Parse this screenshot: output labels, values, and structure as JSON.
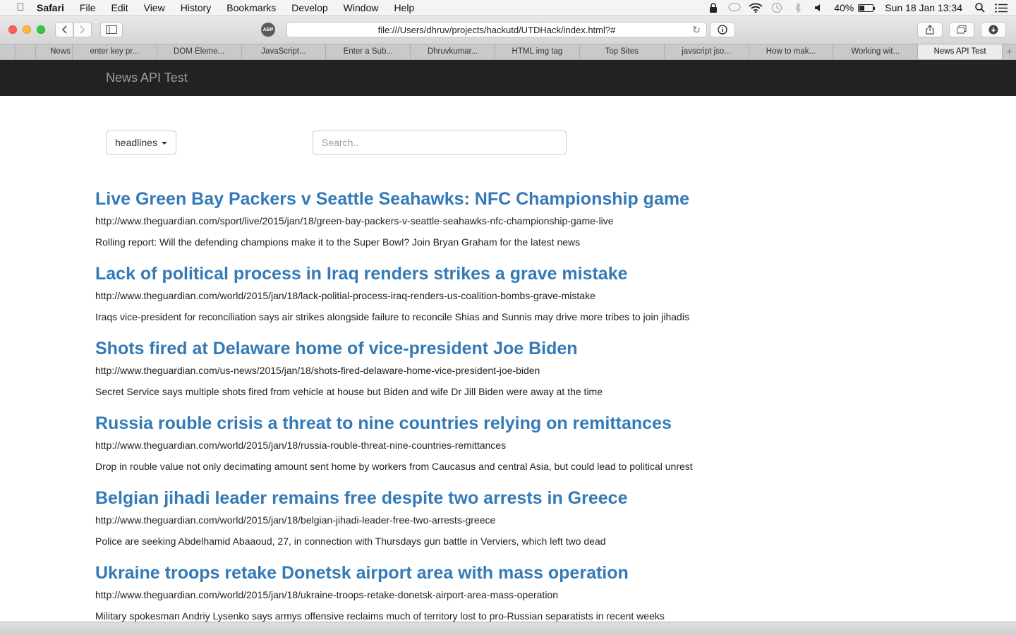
{
  "menubar": {
    "app_name": "Safari",
    "items": [
      "File",
      "Edit",
      "View",
      "History",
      "Bookmarks",
      "Develop",
      "Window",
      "Help"
    ],
    "battery_percent": "40%",
    "battery_level": 0.4,
    "clock": "Sun 18 Jan  13:34"
  },
  "toolbar": {
    "adblock_label": "ABP",
    "url": "file:///Users/dhruv/projects/hackutd/UTDHack/index.html?#"
  },
  "tabs": [
    {
      "label": ""
    },
    {
      "label": "News"
    },
    {
      "label": "enter key pr..."
    },
    {
      "label": "DOM Eleme..."
    },
    {
      "label": "JavaScript..."
    },
    {
      "label": "Enter a Sub..."
    },
    {
      "label": "Dhruvkumar..."
    },
    {
      "label": "HTML img tag"
    },
    {
      "label": "Top Sites"
    },
    {
      "label": "javscript jso..."
    },
    {
      "label": "How to mak..."
    },
    {
      "label": "Working wit..."
    },
    {
      "label": "News API Test"
    }
  ],
  "page": {
    "brand": "News API Test",
    "dropdown_label": "headlines",
    "search_placeholder": "Search.."
  },
  "articles": [
    {
      "title": "Live Green Bay Packers v Seattle Seahawks: NFC Championship game",
      "url": "http://www.theguardian.com/sport/live/2015/jan/18/green-bay-packers-v-seattle-seahawks-nfc-championship-game-live",
      "description": "Rolling report: Will the defending champions make it to the Super Bowl? Join Bryan Graham for the latest news"
    },
    {
      "title": "Lack of political process in Iraq renders strikes a grave mistake",
      "url": "http://www.theguardian.com/world/2015/jan/18/lack-politial-process-iraq-renders-us-coalition-bombs-grave-mistake",
      "description": "Iraqs vice-president for reconciliation says air strikes alongside failure to reconcile Shias and Sunnis may drive more tribes to join jihadis"
    },
    {
      "title": "Shots fired at Delaware home of vice-president Joe Biden",
      "url": "http://www.theguardian.com/us-news/2015/jan/18/shots-fired-delaware-home-vice-president-joe-biden",
      "description": "Secret Service says multiple shots fired from vehicle at house but Biden and wife Dr Jill Biden were away at the time"
    },
    {
      "title": "Russia rouble crisis a threat to nine countries relying on remittances",
      "url": "http://www.theguardian.com/world/2015/jan/18/russia-rouble-threat-nine-countries-remittances",
      "description": "Drop in rouble value not only decimating amount sent home by workers from Caucasus and central Asia, but could lead to political unrest"
    },
    {
      "title": "Belgian jihadi leader remains free despite two arrests in Greece",
      "url": "http://www.theguardian.com/world/2015/jan/18/belgian-jihadi-leader-free-two-arrests-greece",
      "description": "Police are seeking Abdelhamid Abaaoud, 27, in connection with Thursdays gun battle in Verviers, which left two dead"
    },
    {
      "title": "Ukraine troops retake Donetsk airport area with mass operation",
      "url": "http://www.theguardian.com/world/2015/jan/18/ukraine-troops-retake-donetsk-airport-area-mass-operation",
      "description": "Military spokesman Andriy Lysenko says armys offensive reclaims much of territory lost to pro-Russian separatists in recent weeks"
    }
  ]
}
